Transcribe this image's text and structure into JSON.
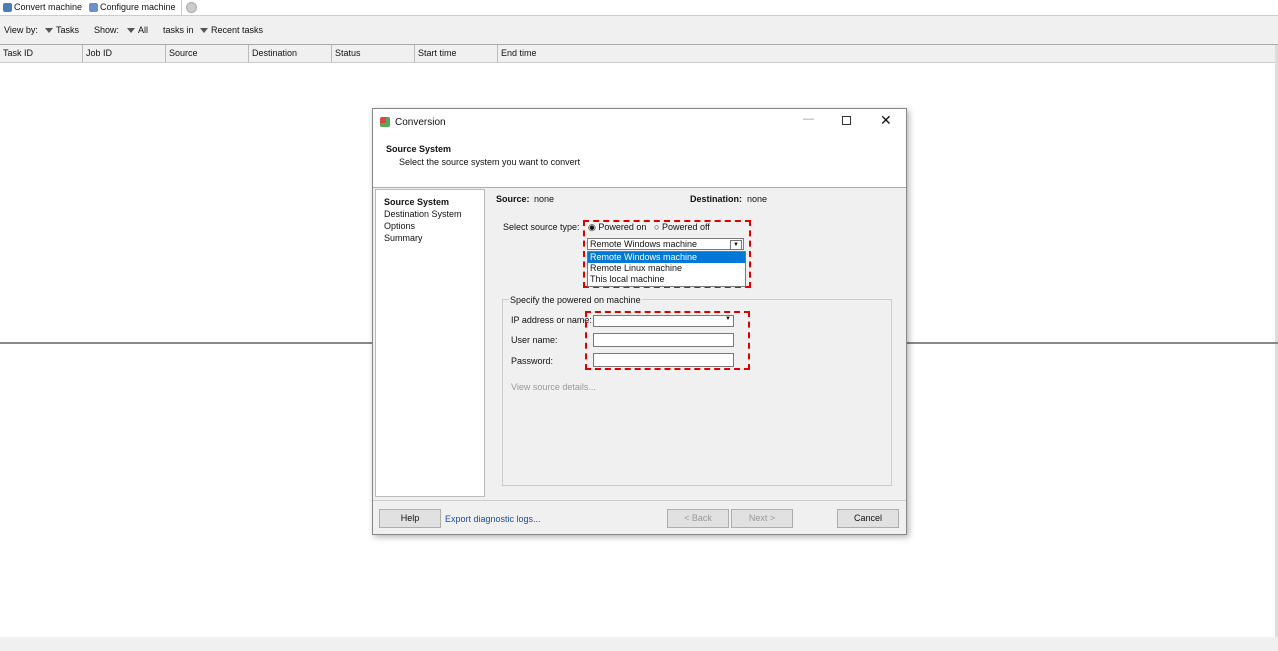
{
  "toolbar": {
    "convert": "Convert machine",
    "configure": "Configure machine"
  },
  "viewbar": {
    "view_by": "View by:",
    "view_value": "Tasks",
    "show": "Show:",
    "show_value": "All",
    "tasks_in": "tasks in",
    "recent": "Recent tasks"
  },
  "columns": [
    "Task ID",
    "Job ID",
    "Source",
    "Destination",
    "Status",
    "Start time",
    "End time"
  ],
  "dialog": {
    "title": "Conversion",
    "heading": "Source System",
    "subheading": "Select the source system you want to convert",
    "nav": [
      "Source System",
      "Destination System",
      "Options",
      "Summary"
    ],
    "source_label": "Source:",
    "source_value": "none",
    "dest_label": "Destination:",
    "dest_value": "none",
    "select_type": "Select source type:",
    "powered_on": "Powered on",
    "powered_off": "Powered off",
    "combo_value": "Remote Windows machine",
    "options": [
      "Remote Windows machine",
      "Remote Linux machine",
      "This local machine"
    ],
    "group_title": "Specify the powered on machine",
    "ip_label": "IP address or name:",
    "user_label": "User name:",
    "password_label": "Password:",
    "view_details": "View source details...",
    "help": "Help",
    "export": "Export diagnostic logs...",
    "back": "< Back",
    "next": "Next >",
    "cancel": "Cancel"
  }
}
